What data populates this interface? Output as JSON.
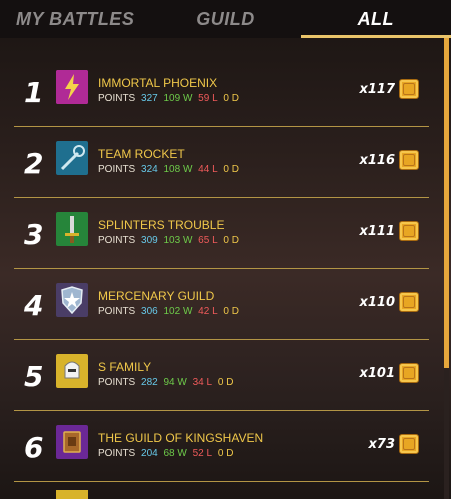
{
  "tabs": [
    {
      "label": "MY BATTLES",
      "active": false
    },
    {
      "label": "GUILD",
      "active": false
    },
    {
      "label": "ALL",
      "active": true
    }
  ],
  "guilds": [
    {
      "rank": "1",
      "name": "IMMORTAL PHOENIX",
      "points_label": "POINTS",
      "points": "327",
      "wins": "109 W",
      "losses": "59 L",
      "draws": "0 D",
      "count": "x117",
      "emblem": "lightning-emblem-icon",
      "emblem_color": "#c030a0"
    },
    {
      "rank": "2",
      "name": "TEAM ROCKET",
      "points_label": "POINTS",
      "points": "324",
      "wins": "108 W",
      "losses": "44 L",
      "draws": "0 D",
      "count": "x116",
      "emblem": "wand-emblem-icon",
      "emblem_color": "#2b8fb0"
    },
    {
      "rank": "3",
      "name": "SPLINTERS TROUBLE",
      "points_label": "POINTS",
      "points": "309",
      "wins": "103 W",
      "losses": "65 L",
      "draws": "0 D",
      "count": "x111",
      "emblem": "sword-emblem-icon",
      "emblem_color": "#2f9a3c"
    },
    {
      "rank": "4",
      "name": "MERCENARY GUILD",
      "points_label": "POINTS",
      "points": "306",
      "wins": "102 W",
      "losses": "42 L",
      "draws": "0 D",
      "count": "x110",
      "emblem": "shield-emblem-icon",
      "emblem_color": "#5a4a7a"
    },
    {
      "rank": "5",
      "name": "S FAMILY",
      "points_label": "POINTS",
      "points": "282",
      "wins": "94 W",
      "losses": "34 L",
      "draws": "0 D",
      "count": "x101",
      "emblem": "helmet-emblem-icon",
      "emblem_color": "#d8b32b"
    },
    {
      "rank": "6",
      "name": "THE GUILD OF KINGSHAVEN",
      "points_label": "POINTS",
      "points": "204",
      "wins": "68 W",
      "losses": "52 L",
      "draws": "0 D",
      "count": "x73",
      "emblem": "book-emblem-icon",
      "emblem_color": "#7a2fa8"
    }
  ],
  "reward_icon": "chest-icon",
  "colors": {
    "accent": "#e9c46a",
    "name": "#f0c84a",
    "points": "#67c8e8",
    "wins": "#6ecb4a",
    "losses": "#ef5a5a",
    "draws": "#f0c84a"
  }
}
